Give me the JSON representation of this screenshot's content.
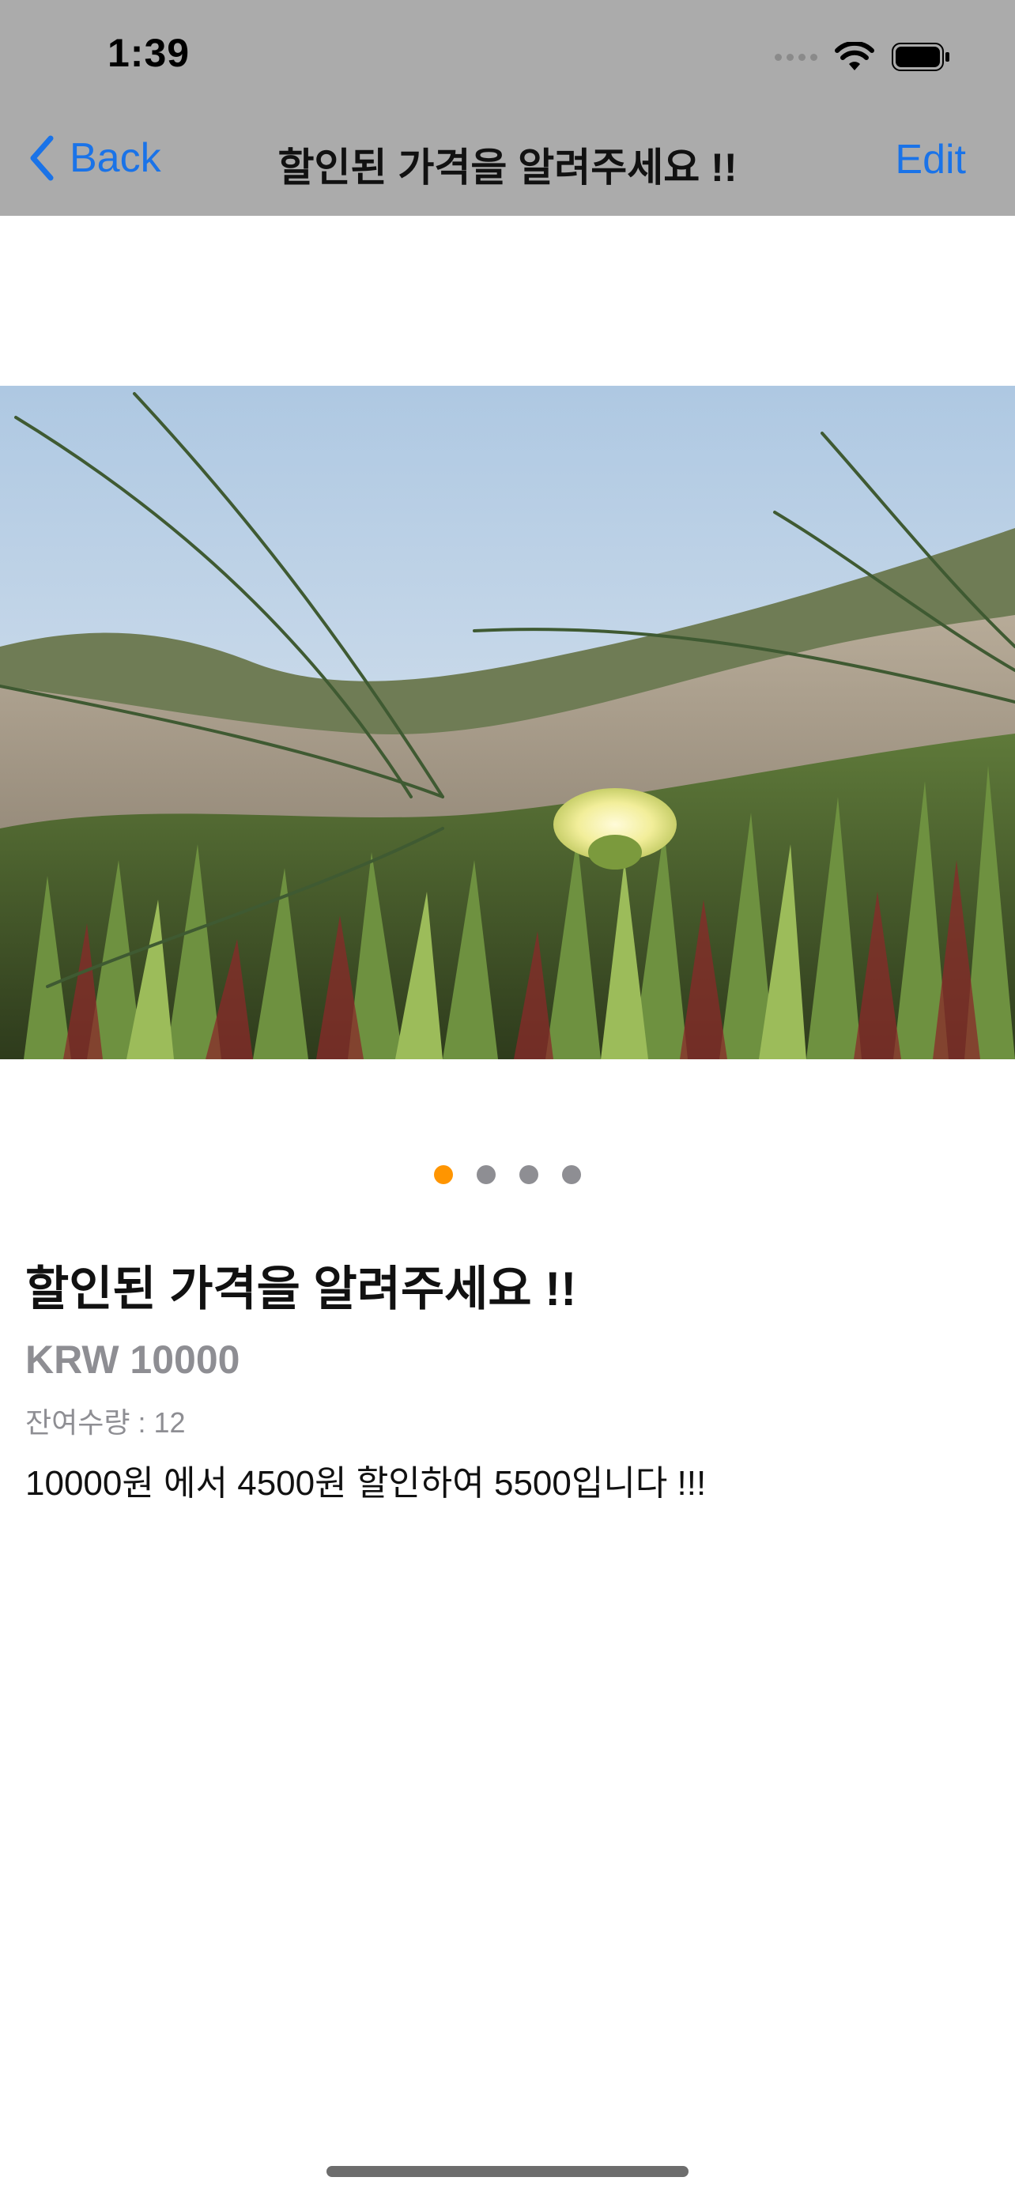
{
  "status_bar": {
    "time": "1:39"
  },
  "nav_bar": {
    "back_label": "Back",
    "title": "할인된 가격을 알려주세요 !!",
    "edit_label": "Edit"
  },
  "carousel": {
    "page_count": 4,
    "current_page": 1
  },
  "product": {
    "title": "할인된 가격을 알려주세요 !!",
    "price": "KRW 10000",
    "stock": "잔여수량 : 12",
    "description": "10000원 에서 4500원 할인하여 5500입니다 !!!"
  },
  "colors": {
    "nav_background": "#ababab",
    "tint": "#1a73e8",
    "page_dot_active": "#ff9500",
    "page_dot_inactive": "#8e8e93",
    "secondary_text": "#8e8e93"
  }
}
